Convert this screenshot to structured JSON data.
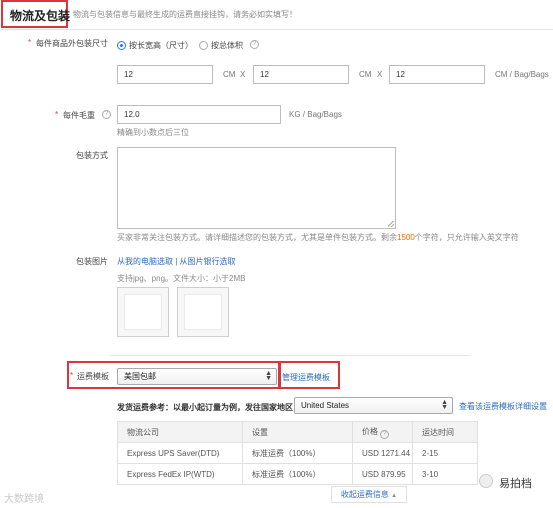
{
  "header": {
    "title": "物流及包装",
    "note": "物流与包装信息与最终生成的运费直接挂钩，请务必如实填写！"
  },
  "package_size": {
    "required_mark": "*",
    "label": "每件商品外包装尺寸",
    "options": [
      {
        "label": "按长宽高（尺寸）",
        "selected": true
      },
      {
        "label": "按总体积",
        "selected": false
      }
    ],
    "help_icon": "?",
    "length": "12",
    "width": "12",
    "height": "12",
    "unit_cm": "CM",
    "sep_x": "X",
    "unit_last": "CM  /  Bag/Bags"
  },
  "gross_weight": {
    "required_mark": "*",
    "label": "每件毛重",
    "help_icon": "?",
    "value": "12.0",
    "unit": "KG  /  Bag/Bags",
    "hint": "精确到小数点后三位"
  },
  "packing_method": {
    "label": "包装方式",
    "hint_before": "买家非常关注包装方式。请详细描述您的包装方式，尤其是单件包装方式。剩余",
    "remaining": "1500",
    "hint_after": "个字符，只允许输入英文字符"
  },
  "packing_images": {
    "label": "包装图片",
    "link_computer": "从我的电脑选取",
    "divider": "|",
    "link_bank": "从图片银行选取",
    "hint": "支持jpg、png。文件大小：小于2MB"
  },
  "shipping": {
    "required_mark": "*",
    "label": "运费模板",
    "selected_template": "美国包邮",
    "manage_link": "管理运费模板",
    "ref_label": "发货运费参考：以最小起订量为例，发往国家地区",
    "country": "United States",
    "detail_link": "查看该运费模板详细设置",
    "table": {
      "headers": [
        "物流公司",
        "设置",
        "价格",
        "运达时间"
      ],
      "price_help_icon": "?",
      "rows": [
        [
          "Express UPS Saver(DTD)",
          "标准运费（100%）",
          "USD 1271.44",
          "2-15"
        ],
        [
          "Express FedEx IP(WTD)",
          "标准运费（100%）",
          "USD 879.95",
          "3-10"
        ]
      ]
    },
    "collapse_label": "收起运费信息",
    "collapse_arrow": "▲"
  },
  "watermark": {
    "left": "大数跨境",
    "right_brand": "易拍档"
  },
  "colors": {
    "highlight_red": "#d9363e",
    "link_blue": "#2a6bc6",
    "radio_blue": "#2a7ae2",
    "counter_orange": "#ff6600"
  }
}
